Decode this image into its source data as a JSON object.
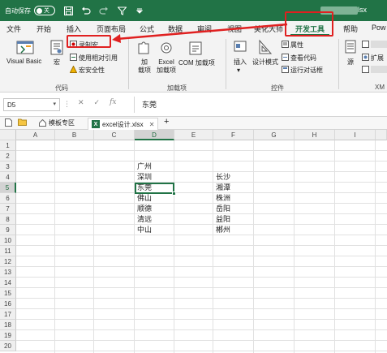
{
  "titlebar": {
    "autosave_label": "自动保存",
    "autosave_state": "关",
    "filename": "lsx"
  },
  "menu": {
    "tabs": [
      "文件",
      "开始",
      "插入",
      "页面布局",
      "公式",
      "数据",
      "审阅",
      "视图",
      "美化大师",
      "开发工具",
      "帮助",
      "Pow"
    ],
    "active": "开发工具"
  },
  "ribbon": {
    "visual_basic": "Visual Basic",
    "macro": "宏",
    "record_macro": "录制宏",
    "relative_ref": "使用相对引用",
    "macro_security": "宏安全性",
    "group_code": "代码",
    "addins": "加\n载项",
    "excel_addins": "Excel\n加载项",
    "com_addins": "COM 加载项",
    "group_addins": "加载项",
    "insert": "插入",
    "design_mode": "设计模式",
    "properties": "属性",
    "view_code": "查看代码",
    "run_dialog": "运行对话框",
    "group_controls": "控件",
    "source": "源",
    "expansion": "扩展",
    "group_xml": "XM"
  },
  "formula_bar": {
    "name_box": "D5",
    "formula": "东莞"
  },
  "doc_tabs": {
    "template": "模板专区",
    "file": "excel设计.xlsx",
    "add": "+"
  },
  "grid": {
    "columns": [
      "A",
      "B",
      "C",
      "D",
      "E",
      "F",
      "G",
      "H",
      "I"
    ],
    "rows": [
      "1",
      "2",
      "3",
      "4",
      "5",
      "6",
      "7",
      "8",
      "9",
      "10",
      "11",
      "12",
      "13",
      "14",
      "15",
      "16",
      "17",
      "18",
      "19",
      "20"
    ],
    "selected_cell": "D5",
    "col_d": [
      "广州",
      "深圳",
      "东莞",
      "佛山",
      "顺德",
      "清远",
      "中山"
    ],
    "col_f": [
      "长沙",
      "湘潭",
      "株洲",
      "岳阳",
      "益阳",
      "郴州"
    ]
  },
  "colors": {
    "excel_green": "#217346",
    "highlight_red": "#e02020"
  }
}
